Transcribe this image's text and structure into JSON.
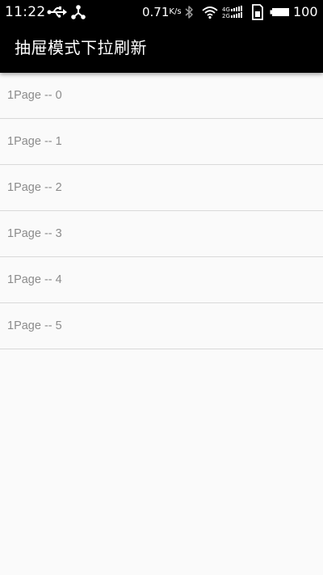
{
  "status_bar": {
    "time": "11:22",
    "network_speed": "0.71",
    "network_speed_unit": "K/s",
    "battery_level": "100",
    "icons": [
      "usb-icon",
      "share-icon",
      "bluetooth-icon",
      "wifi-icon",
      "signal-4g-icon",
      "sim-card-icon",
      "battery-icon"
    ]
  },
  "app_bar": {
    "title": "抽屉模式下拉刷新",
    "background_color": "#000000"
  },
  "list": {
    "items": [
      {
        "label": "1Page -- 0"
      },
      {
        "label": "1Page -- 1"
      },
      {
        "label": "1Page -- 2"
      },
      {
        "label": "1Page -- 3"
      },
      {
        "label": "1Page -- 4"
      },
      {
        "label": "1Page -- 5"
      }
    ]
  }
}
